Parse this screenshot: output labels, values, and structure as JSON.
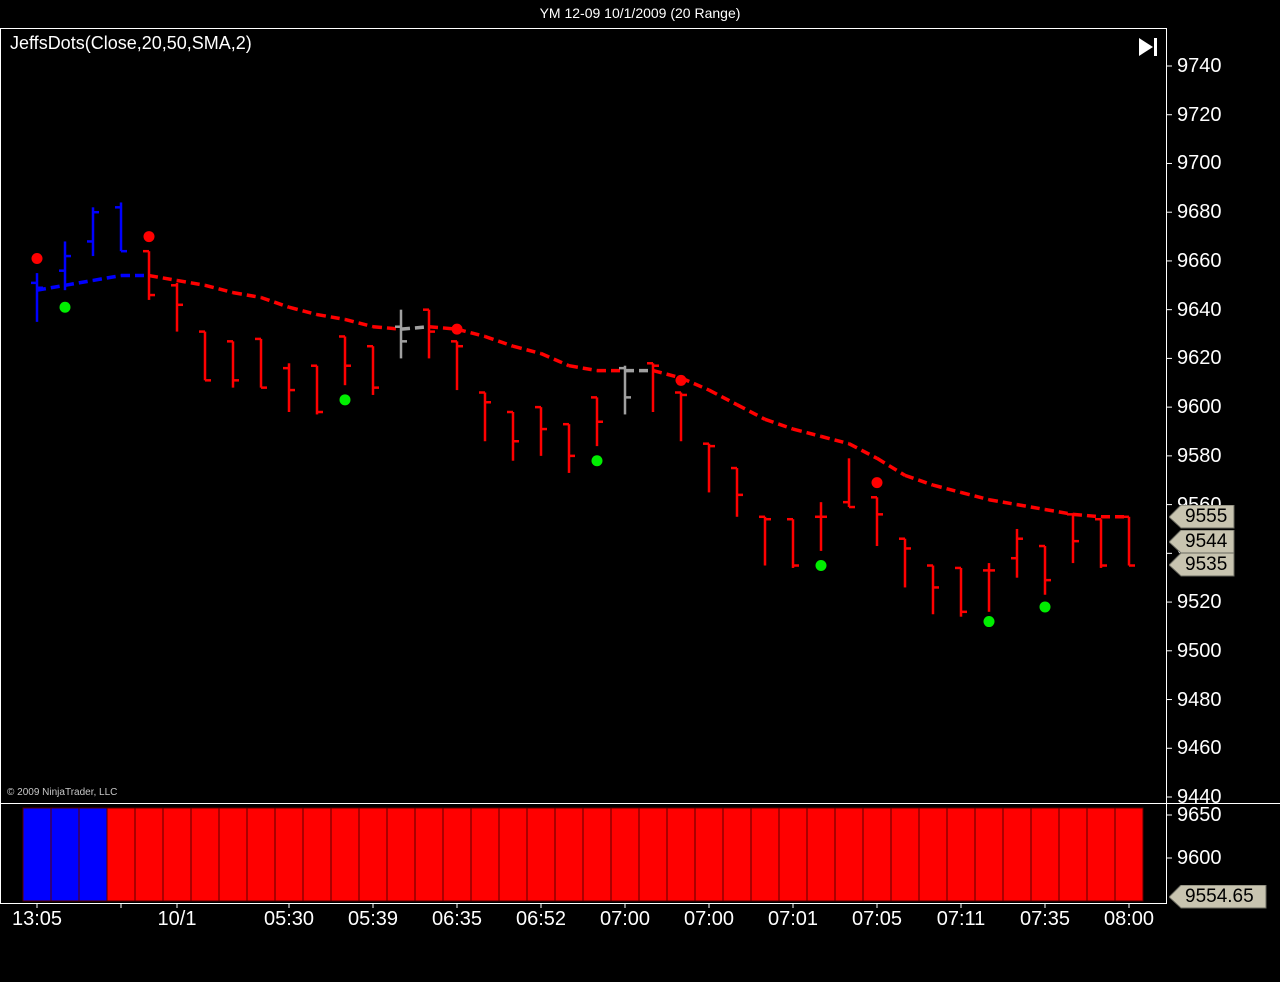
{
  "window": {
    "title": "YM 12-09  10/1/2009 (20 Range)"
  },
  "indicator_label": "JeffsDots(Close,20,50,SMA,2)",
  "copyright": "© 2009 NinjaTrader, LLC",
  "icons": {
    "nav": "skip-to-end-icon"
  },
  "colors": {
    "background": "#000000",
    "up_trend": "#0000ff",
    "down_trend": "#ff0000",
    "neutral": "#a0a0a0",
    "buy_dot": "#00ee00",
    "sell_dot": "#ff0000",
    "axis": "#ffffff",
    "price_tag": "#c8c4b0"
  },
  "chart_data": [
    {
      "type": "ohlc",
      "title": "YM 12-09  10/1/2009 (20 Range)",
      "indicator": "JeffsDots(Close,20,50,SMA,2)",
      "ylim": [
        9440,
        9740
      ],
      "yticks": [
        9740,
        9720,
        9700,
        9680,
        9660,
        9640,
        9620,
        9600,
        9580,
        9560,
        9540,
        9520,
        9500,
        9480,
        9460,
        9440
      ],
      "x_labels": [
        "13:05",
        "10/1",
        "05:30",
        "05:39",
        "06:35",
        "06:52",
        "07:00",
        "07:00",
        "07:01",
        "07:05",
        "07:11",
        "07:35",
        "08:00"
      ],
      "price_tags": [
        9555,
        9544,
        9535
      ],
      "bars": [
        {
          "o": 9651,
          "h": 9655,
          "l": 9635,
          "c": 9649,
          "color": "blue"
        },
        {
          "o": 9656,
          "h": 9668,
          "l": 9648,
          "c": 9662,
          "color": "blue"
        },
        {
          "o": 9668,
          "h": 9682,
          "l": 9662,
          "c": 9680,
          "color": "blue"
        },
        {
          "o": 9682,
          "h": 9684,
          "l": 9664,
          "c": 9664,
          "color": "blue"
        },
        {
          "o": 9664,
          "h": 9664,
          "l": 9644,
          "c": 9646,
          "color": "red"
        },
        {
          "o": 9650,
          "h": 9651,
          "l": 9631,
          "c": 9642,
          "color": "red"
        },
        {
          "o": 9631,
          "h": 9631,
          "l": 9611,
          "c": 9611,
          "color": "red"
        },
        {
          "o": 9627,
          "h": 9627,
          "l": 9608,
          "c": 9611,
          "color": "red"
        },
        {
          "o": 9628,
          "h": 9628,
          "l": 9608,
          "c": 9608,
          "color": "red"
        },
        {
          "o": 9616,
          "h": 9618,
          "l": 9598,
          "c": 9607,
          "color": "red"
        },
        {
          "o": 9617,
          "h": 9617,
          "l": 9597,
          "c": 9598,
          "color": "red"
        },
        {
          "o": 9629,
          "h": 9629,
          "l": 9609,
          "c": 9617,
          "color": "red"
        },
        {
          "o": 9625,
          "h": 9625,
          "l": 9605,
          "c": 9608,
          "color": "red"
        },
        {
          "o": 9633,
          "h": 9640,
          "l": 9620,
          "c": 9627,
          "color": "gray"
        },
        {
          "o": 9640,
          "h": 9640,
          "l": 9620,
          "c": 9631,
          "color": "red"
        },
        {
          "o": 9627,
          "h": 9627,
          "l": 9607,
          "c": 9625,
          "color": "red"
        },
        {
          "o": 9606,
          "h": 9606,
          "l": 9586,
          "c": 9602,
          "color": "red"
        },
        {
          "o": 9598,
          "h": 9598,
          "l": 9578,
          "c": 9586,
          "color": "red"
        },
        {
          "o": 9600,
          "h": 9600,
          "l": 9580,
          "c": 9591,
          "color": "red"
        },
        {
          "o": 9593,
          "h": 9593,
          "l": 9573,
          "c": 9580,
          "color": "red"
        },
        {
          "o": 9604,
          "h": 9604,
          "l": 9584,
          "c": 9594,
          "color": "red"
        },
        {
          "o": 9616,
          "h": 9617,
          "l": 9597,
          "c": 9604,
          "color": "gray"
        },
        {
          "o": 9618,
          "h": 9618,
          "l": 9598,
          "c": 9617,
          "color": "red"
        },
        {
          "o": 9606,
          "h": 9606,
          "l": 9586,
          "c": 9605,
          "color": "red"
        },
        {
          "o": 9585,
          "h": 9585,
          "l": 9565,
          "c": 9584,
          "color": "red"
        },
        {
          "o": 9575,
          "h": 9575,
          "l": 9555,
          "c": 9564,
          "color": "red"
        },
        {
          "o": 9555,
          "h": 9555,
          "l": 9535,
          "c": 9554,
          "color": "red"
        },
        {
          "o": 9554,
          "h": 9554,
          "l": 9534,
          "c": 9535,
          "color": "red"
        },
        {
          "o": 9555,
          "h": 9561,
          "l": 9541,
          "c": 9555,
          "color": "red"
        },
        {
          "o": 9561,
          "h": 9579,
          "l": 9559,
          "c": 9559,
          "color": "red"
        },
        {
          "o": 9563,
          "h": 9563,
          "l": 9543,
          "c": 9556,
          "color": "red"
        },
        {
          "o": 9546,
          "h": 9546,
          "l": 9526,
          "c": 9542,
          "color": "red"
        },
        {
          "o": 9535,
          "h": 9535,
          "l": 9515,
          "c": 9526,
          "color": "red"
        },
        {
          "o": 9534,
          "h": 9534,
          "l": 9514,
          "c": 9516,
          "color": "red"
        },
        {
          "o": 9533,
          "h": 9536,
          "l": 9516,
          "c": 9533,
          "color": "red"
        },
        {
          "o": 9538,
          "h": 9550,
          "l": 9530,
          "c": 9546,
          "color": "red"
        },
        {
          "o": 9543,
          "h": 9543,
          "l": 9523,
          "c": 9529,
          "color": "red"
        },
        {
          "o": 9556,
          "h": 9556,
          "l": 9536,
          "c": 9545,
          "color": "red"
        },
        {
          "o": 9554,
          "h": 9554,
          "l": 9534,
          "c": 9535,
          "color": "red"
        },
        {
          "o": 9555,
          "h": 9555,
          "l": 9535,
          "c": 9535,
          "color": "red"
        }
      ],
      "series": [
        {
          "values": [
            9648,
            9650,
            9652,
            9654,
            9654,
            9652,
            9650,
            9647,
            9645,
            9641,
            9638,
            9636,
            9633,
            9632,
            9633,
            9632,
            9629,
            9625,
            9622,
            9617,
            9615,
            9615,
            9615,
            9612,
            9607,
            9601,
            9595,
            9591,
            9588,
            9585,
            9579,
            9572,
            9568,
            9565,
            9562,
            9560,
            9558,
            9556,
            9555,
            9555
          ],
          "colors_by_bar": [
            "blue",
            "blue",
            "blue",
            "blue",
            "red",
            "red",
            "red",
            "red",
            "red",
            "red",
            "red",
            "red",
            "red",
            "gray",
            "red",
            "red",
            "red",
            "red",
            "red",
            "red",
            "red",
            "gray",
            "red",
            "red",
            "red",
            "red",
            "red",
            "red",
            "red",
            "red",
            "red",
            "red",
            "red",
            "red",
            "red",
            "red",
            "red",
            "red",
            "red",
            "red"
          ]
        }
      ],
      "dots": [
        {
          "bar": 0,
          "y": 9661,
          "color": "red"
        },
        {
          "bar": 1,
          "y": 9641,
          "color": "green"
        },
        {
          "bar": 4,
          "y": 9670,
          "color": "red"
        },
        {
          "bar": 11,
          "y": 9603,
          "color": "green"
        },
        {
          "bar": 15,
          "y": 9632,
          "color": "red"
        },
        {
          "bar": 20,
          "y": 9578,
          "color": "green"
        },
        {
          "bar": 23,
          "y": 9611,
          "color": "red"
        },
        {
          "bar": 28,
          "y": 9535,
          "color": "green"
        },
        {
          "bar": 30,
          "y": 9569,
          "color": "red"
        },
        {
          "bar": 34,
          "y": 9512,
          "color": "green"
        },
        {
          "bar": 36,
          "y": 9518,
          "color": "green"
        }
      ]
    },
    {
      "type": "bar",
      "ylim": [
        9550,
        9650
      ],
      "yticks": [
        9650,
        9600
      ],
      "price_tag": "9554.65",
      "colors_by_bar": [
        "blue",
        "blue",
        "blue",
        "red",
        "red",
        "red",
        "red",
        "red",
        "red",
        "red",
        "red",
        "red",
        "red",
        "red",
        "red",
        "red",
        "red",
        "red",
        "red",
        "red",
        "red",
        "red",
        "red",
        "red",
        "red",
        "red",
        "red",
        "red",
        "red",
        "red",
        "red",
        "red",
        "red",
        "red",
        "red",
        "red",
        "red",
        "red",
        "red",
        "red",
        "red",
        "red",
        "red",
        "red"
      ]
    }
  ]
}
